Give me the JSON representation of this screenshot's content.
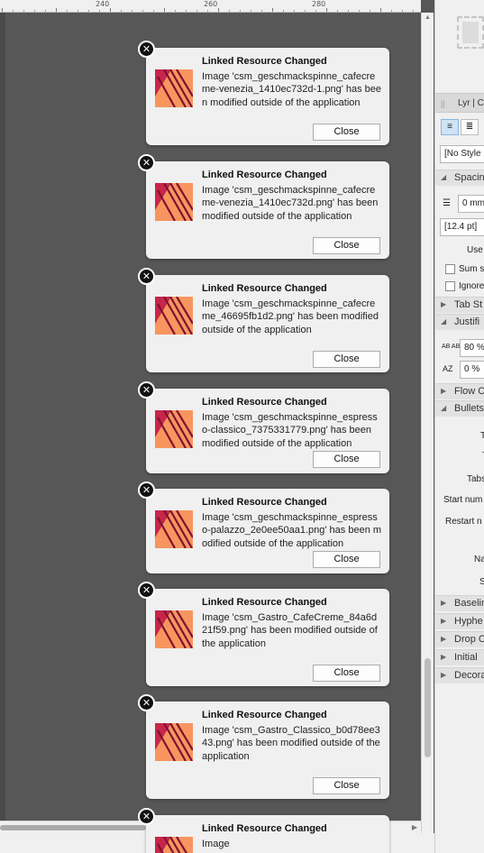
{
  "ruler": {
    "labels": [
      "240",
      "260",
      "280"
    ]
  },
  "notification_icon": "affinity-publisher-icon",
  "notifications": [
    {
      "title": "Linked Resource Changed",
      "message": "Image 'csm_geschmackspinne_cafecreme-venezia_1410ec732d-1.png' has been modified outside of the application",
      "button": "Close"
    },
    {
      "title": "Linked Resource Changed",
      "message": "Image 'csm_geschmackspinne_cafecreme-venezia_1410ec732d.png' has been modified outside of the application",
      "button": "Close"
    },
    {
      "title": "Linked Resource Changed",
      "message": "Image 'csm_geschmackspinne_cafecreme_46695fb1d2.png' has been modified outside of the application",
      "button": "Close"
    },
    {
      "title": "Linked Resource Changed",
      "message": "Image 'csm_geschmackspinne_espresso-classico_7375331779.png' has been modified outside of the application",
      "button": "Close"
    },
    {
      "title": "Linked Resource Changed",
      "message": "Image 'csm_geschmackspinne_espresso-palazzo_2e0ee50aa1.png' has been modified outside of the application",
      "button": "Close"
    },
    {
      "title": "Linked Resource Changed",
      "message": "Image 'csm_Gastro_CafeCreme_84a6d21f59.png' has been modified outside of the application",
      "button": "Close"
    },
    {
      "title": "Linked Resource Changed",
      "message": "Image 'csm_Gastro_Classico_b0d78ee343.png' has been modified outside of the application",
      "button": "Close"
    },
    {
      "title": "Linked Resource Changed",
      "message": "Image",
      "button": "Close"
    }
  ],
  "panel": {
    "tabs": "Lyr | C",
    "align_left_icon": "align-left-icon",
    "align_center_icon": "align-center-icon",
    "style_select": "[No Style",
    "sections": {
      "spacing": "Spacin",
      "tab_stops": "Tab St",
      "justification": "Justifi",
      "flow": "Flow C",
      "bullets": "Bullets",
      "baseline": "Baselin",
      "hyphenation": "Hyphe",
      "drop_caps": "Drop C",
      "initial": "Initial",
      "decorations": "Decora"
    },
    "spacing_value": "0 mm",
    "leading_value": "[12.4 pt]",
    "use_label": "Use",
    "sum_label": "Sum s",
    "ignore_label": "Ignore",
    "word_spacing": "80 %",
    "letter_spacing": "0 %",
    "bullets_labels": [
      "T",
      "T",
      "Tabs",
      "Start num",
      "Restart n",
      "Na",
      "S"
    ]
  },
  "colors": {
    "canvas_bg": "#575757",
    "toast_bg": "#f0f0f0",
    "icon_orange": "#f8955f",
    "icon_red": "#c7264a",
    "icon_stripe": "#7a1430"
  }
}
